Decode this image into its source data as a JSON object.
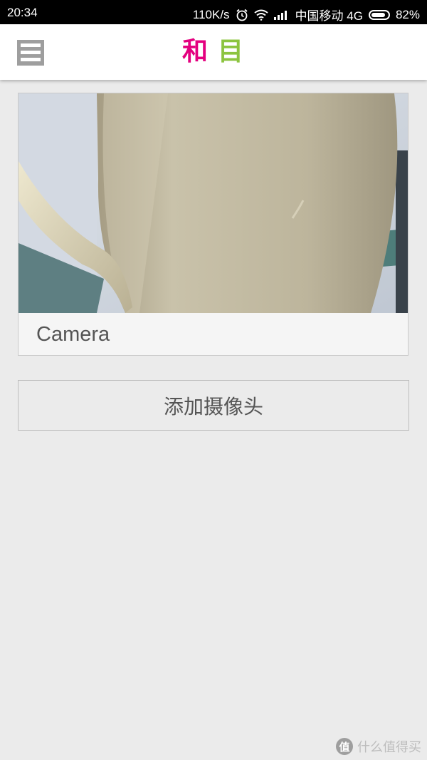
{
  "status_bar": {
    "time": "20:34",
    "net_speed": "110K/s",
    "carrier": "中国移动 4G",
    "battery": "82%",
    "icons": [
      "alarm-icon",
      "wifi-icon",
      "signal-icon",
      "battery-icon"
    ]
  },
  "app_bar": {
    "logo_char1": "和",
    "logo_char2": "目",
    "logo_color1": "#e4007f",
    "logo_color2": "#8cc43f"
  },
  "camera_card": {
    "label": "Camera"
  },
  "add_camera": {
    "label": "添加摄像头"
  },
  "watermark": {
    "glyph": "值",
    "text": "什么值得买"
  }
}
